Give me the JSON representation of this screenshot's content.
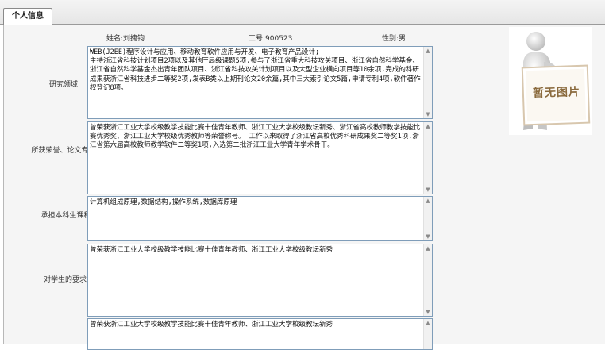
{
  "tab": {
    "label": "个人信息"
  },
  "header": {
    "name": "姓名:刘捷钧",
    "job_id": "工号:900523",
    "gender": "性别:男"
  },
  "photo": {
    "text": "暂无图片"
  },
  "fields": [
    {
      "label": "研究领域",
      "value": "WEB(J2EE)程序设计与应用、移动教育软件应用与开发、电子教育产品设计;\n主持浙江省科技计划项目2项以及其他厅局级课题5项,参与了浙江省重大科技攻关项目、浙江省自然科学基金、浙江省自然科学基金杰出青年团队项目、浙江省科技攻关计划项目以及大型企业横向项目等10余项,完成的科研成果获浙江省科技进步二等奖2项,发表B类以上期刊论文20余篇,其中三大索引论文5篇,申请专利4项,软件著作权登记8项。"
    },
    {
      "label": "所获荣誉、论文专著",
      "value": "曾荣获浙江工业大学校级教学技能比赛十佳青年教师、浙江工业大学校级教坛新秀、浙江省高校教师教学技能比赛优秀奖、浙江工业大学校级优秀教师等荣誉称号。 工作以来取得了浙江省高校优秀科研成果奖二等奖1项,浙江省第六届高校教师教学软件二等奖1项,入选第二批浙江工业大学青年学术骨干。"
    },
    {
      "label": "承担本科生课程",
      "value": "计算机组成原理,数据结构,操作系统,数据库原理"
    },
    {
      "label": "对学生的要求",
      "value": "曾荣获浙江工业大学校级教学技能比赛十佳青年教师、浙江工业大学校级教坛新秀"
    },
    {
      "label": "",
      "value": "曾荣获浙江工业大学校级教学技能比赛十佳青年教师、浙江工业大学校级教坛新秀"
    }
  ]
}
